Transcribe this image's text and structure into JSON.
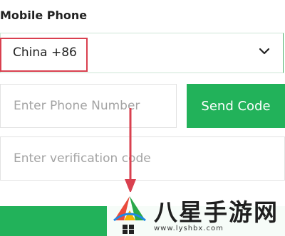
{
  "form": {
    "section_label": "Mobile Phone",
    "country_value": "China +86",
    "phone_placeholder": "Enter Phone Number",
    "send_code_label": "Send Code",
    "code_placeholder": "Enter verification code"
  },
  "watermark": {
    "title": "八星手游网",
    "url": "www.lyshbx.com"
  },
  "colors": {
    "accent_green": "#22b25a",
    "highlight_red": "#d9404f"
  },
  "icons": {
    "dropdown": "chevron-down-icon",
    "watermark_logo": "site-logo-icon"
  }
}
